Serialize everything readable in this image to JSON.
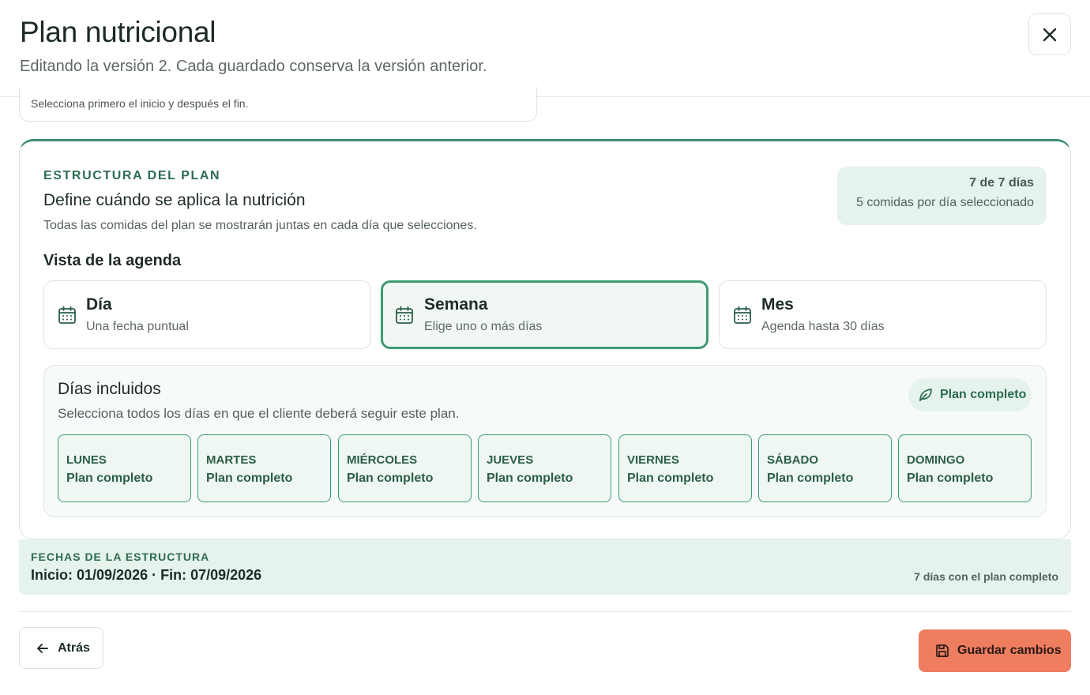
{
  "header": {
    "title": "Plan nutricional",
    "subtitle": "Editando la versión 2. Cada guardado conserva la versión anterior."
  },
  "previous_section": {
    "hint": "Selecciona primero el inicio y después el fin."
  },
  "structure": {
    "kicker": "ESTRUCTURA DEL PLAN",
    "title": "Define cuándo se aplica la nutrición",
    "description": "Todas las comidas del plan se mostrarán juntas en cada día que selecciones.",
    "summary": {
      "count": "7 de 7 días",
      "meals": "5 comidas por día seleccionado"
    },
    "agenda_label": "Vista de la agenda",
    "views": [
      {
        "title": "Día",
        "subtitle": "Una fecha puntual",
        "selected": false,
        "icon": "calendar-icon"
      },
      {
        "title": "Semana",
        "subtitle": "Elige uno o más días",
        "selected": true,
        "icon": "calendar-icon"
      },
      {
        "title": "Mes",
        "subtitle": "Agenda hasta 30 días",
        "selected": false,
        "icon": "calendar-icon"
      }
    ],
    "days_panel": {
      "title": "Días incluidos",
      "description": "Selecciona todos los días en que el cliente deberá seguir este plan.",
      "plan_button": "Plan completo",
      "plan_button_icon": "leaf-icon",
      "days": [
        {
          "name": "LUNES",
          "plan": "Plan completo"
        },
        {
          "name": "MARTES",
          "plan": "Plan completo"
        },
        {
          "name": "MIÉRCOLES",
          "plan": "Plan completo"
        },
        {
          "name": "JUEVES",
          "plan": "Plan completo"
        },
        {
          "name": "VIERNES",
          "plan": "Plan completo"
        },
        {
          "name": "SÁBADO",
          "plan": "Plan completo"
        },
        {
          "name": "DOMINGO",
          "plan": "Plan completo"
        }
      ]
    }
  },
  "dates": {
    "kicker": "FECHAS DE LA ESTRUCTURA",
    "range": "Inicio: 01/09/2026 · Fin: 07/09/2026",
    "days_summary": "7 días con el plan completo"
  },
  "footer": {
    "back_label": "Atrás",
    "save_label": "Guardar cambios"
  },
  "colors": {
    "accent": "#3f8f6d",
    "accent_light": "#e6f2ec",
    "save": "#ef7d60"
  }
}
